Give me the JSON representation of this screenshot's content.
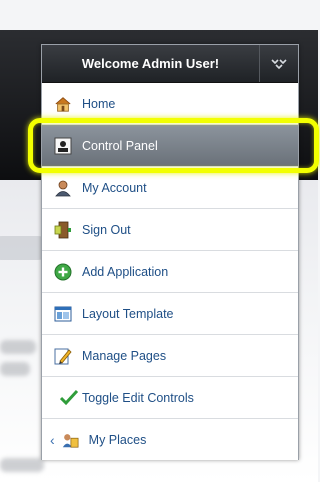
{
  "menu": {
    "title": "Welcome Admin User!",
    "toggle_icon": "collapse-arrows-icon",
    "items": [
      {
        "label": "Home",
        "icon": "home-icon"
      },
      {
        "label": "Control Panel",
        "icon": "control-panel-icon"
      },
      {
        "label": "My Account",
        "icon": "user-icon"
      },
      {
        "label": "Sign Out",
        "icon": "sign-out-icon"
      },
      {
        "label": "Add Application",
        "icon": "add-icon"
      },
      {
        "label": "Layout Template",
        "icon": "layout-icon"
      },
      {
        "label": "Manage Pages",
        "icon": "edit-pages-icon"
      },
      {
        "label": "Toggle Edit Controls",
        "icon": "checkmark-icon"
      },
      {
        "label": "My Places",
        "icon": "my-places-icon"
      }
    ],
    "active_item": "Control Panel"
  },
  "colors": {
    "link": "#1f4f86",
    "highlight": "#f2ff00",
    "header": "#2b2e33"
  }
}
